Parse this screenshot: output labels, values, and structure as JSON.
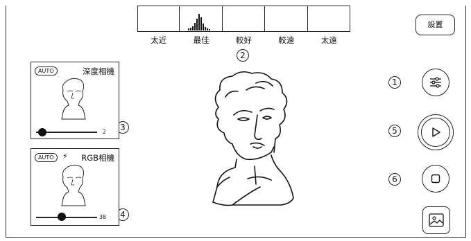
{
  "histogram": {
    "labels": [
      "太近",
      "最佳",
      "較好",
      "較遠",
      "太遠"
    ]
  },
  "markers": {
    "m1": "1",
    "m2": "2",
    "m3": "3",
    "m4": "4",
    "m5": "5",
    "m6": "6"
  },
  "settings": {
    "label": "設置"
  },
  "depth_card": {
    "auto": "AUTO",
    "title": "深度相機",
    "value": "2",
    "slider_fraction": 0.1
  },
  "rgb_card": {
    "auto": "AUTO",
    "title": "RGB相機",
    "value": "38",
    "slider_fraction": 0.38
  },
  "icons": {
    "settings_sliders": "sliders-icon",
    "play": "play-icon",
    "stop": "stop-icon",
    "gallery": "image-icon",
    "bolt": "flash-icon"
  }
}
